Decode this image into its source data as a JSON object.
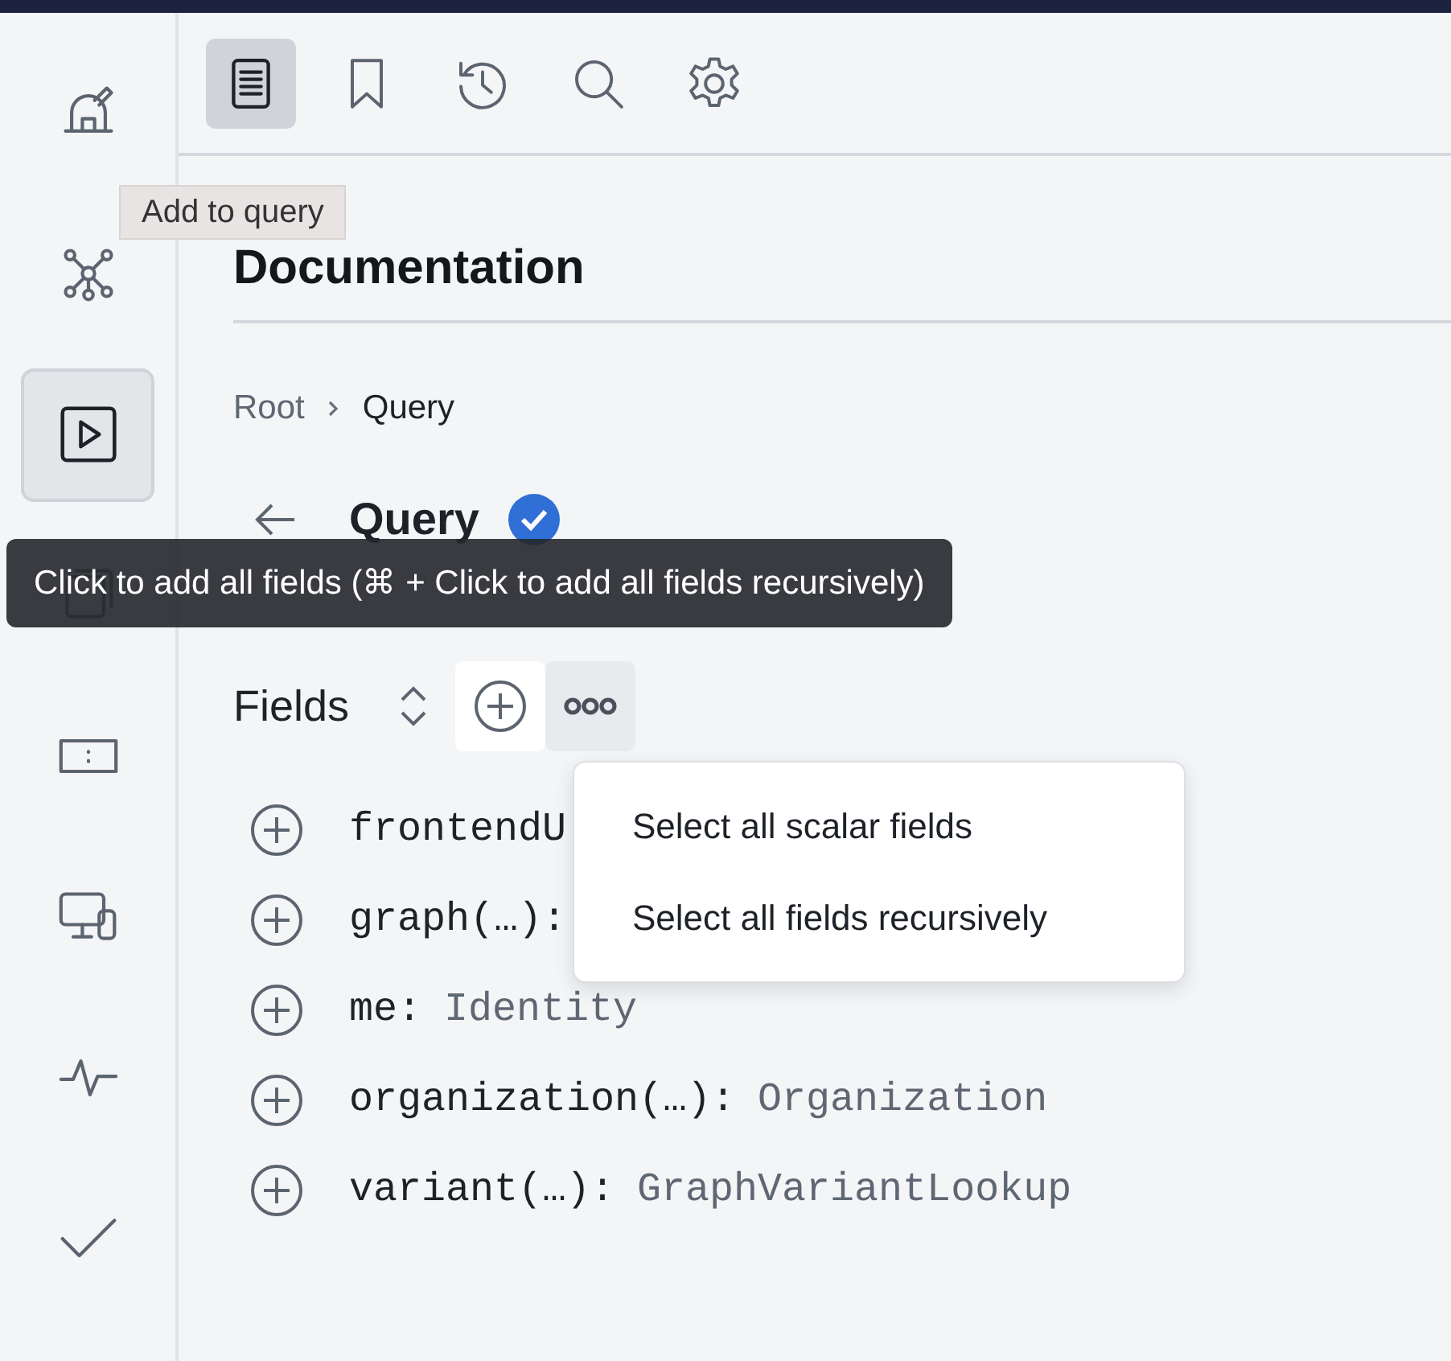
{
  "sidebar": {
    "items": [
      {
        "kind": "observatory",
        "selected": false
      },
      {
        "kind": "graph",
        "selected": false
      },
      {
        "kind": "play",
        "selected": true
      },
      {
        "kind": "pages",
        "selected": false
      },
      {
        "kind": "card",
        "selected": false
      },
      {
        "kind": "devices",
        "selected": false
      },
      {
        "kind": "pulse",
        "selected": false
      },
      {
        "kind": "check",
        "selected": false
      }
    ]
  },
  "toolbar": {
    "tabs": [
      {
        "kind": "document",
        "selected": true
      },
      {
        "kind": "bookmark",
        "selected": false
      },
      {
        "kind": "history",
        "selected": false
      },
      {
        "kind": "search",
        "selected": false
      },
      {
        "kind": "settings",
        "selected": false
      }
    ]
  },
  "heading": "Documentation",
  "breadcrumb": [
    "Root",
    "Query"
  ],
  "type_header": {
    "title": "Query",
    "verified": true
  },
  "fields_header": {
    "label": "Fields"
  },
  "fields": [
    {
      "name": "frontendU"
    },
    {
      "name": "graph(…):"
    },
    {
      "name": "me:",
      "type": "Identity"
    },
    {
      "name": "organization(…):",
      "type": "Organization"
    },
    {
      "name": "variant(…):",
      "type": "GraphVariantLookup"
    }
  ],
  "menu": {
    "items": [
      "Select all scalar fields",
      "Select all fields recursively"
    ]
  },
  "tooltips": [
    {
      "kind": "light",
      "text": "Add to query"
    },
    {
      "kind": "dark",
      "text": "Click to add all fields (⌘ + Click to add all fields recursively)"
    }
  ]
}
